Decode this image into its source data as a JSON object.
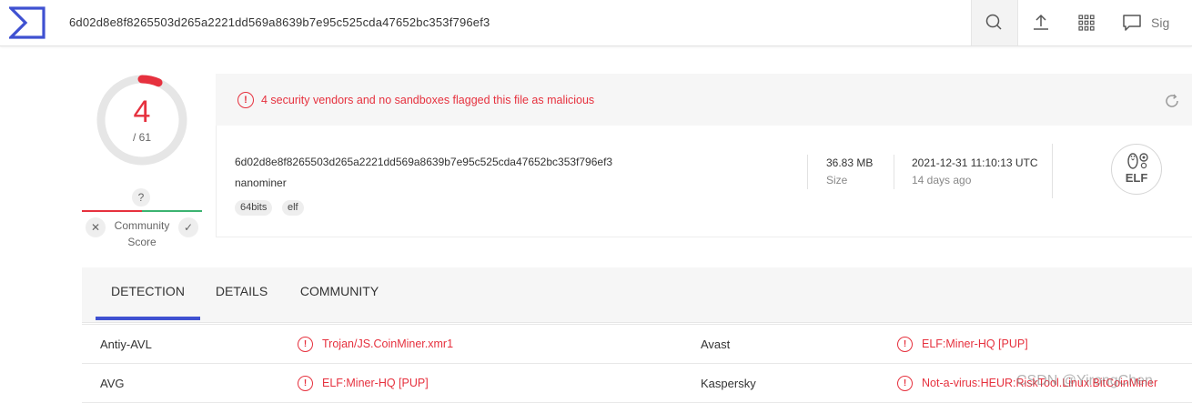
{
  "colors": {
    "accent": "#3f51d1",
    "malicious": "#e6313e",
    "harmless": "#3cb371"
  },
  "topbar": {
    "search_value": "6d02d8e8f8265503d265a2221dd569a8639b7e95c525cda47652bc353f796ef3",
    "icons": [
      "search-icon",
      "upload-icon",
      "apps-grid-icon",
      "chat-icon"
    ],
    "signin_label": "Sig"
  },
  "score": {
    "detections": "4",
    "total": "/ 61",
    "detection_fraction": 0.0656
  },
  "community": {
    "question_mark": "?",
    "downvote_icon": "✕",
    "upvote_icon": "✓",
    "label_line1": "Community",
    "label_line2": "Score"
  },
  "alert": {
    "icon": "!",
    "text": "4 security vendors and no sandboxes flagged this file as malicious"
  },
  "file": {
    "hash": "6d02d8e8f8265503d265a2221dd569a8639b7e95c525cda47652bc353f796ef3",
    "name": "nanominer",
    "tags": [
      "64bits",
      "elf"
    ],
    "size_value": "36.83 MB",
    "size_label": "Size",
    "date_value": "2021-12-31 11:10:13 UTC",
    "date_label": "14 days ago",
    "type_badge": "ELF"
  },
  "tabs": [
    "DETECTION",
    "DETAILS",
    "COMMUNITY"
  ],
  "active_tab": "DETECTION",
  "detections": [
    {
      "vendor_a": "Antiy-AVL",
      "result_a": "Trojan/JS.CoinMiner.xmr1",
      "vendor_b": "Avast",
      "result_b": "ELF:Miner-HQ [PUP]"
    },
    {
      "vendor_a": "AVG",
      "result_a": "ELF:Miner-HQ [PUP]",
      "vendor_b": "Kaspersky",
      "result_b": "Not-a-virus:HEUR:RiskTool.Linux.BitCoinMiner"
    }
  ],
  "watermark": "CSDN @YirongChen"
}
